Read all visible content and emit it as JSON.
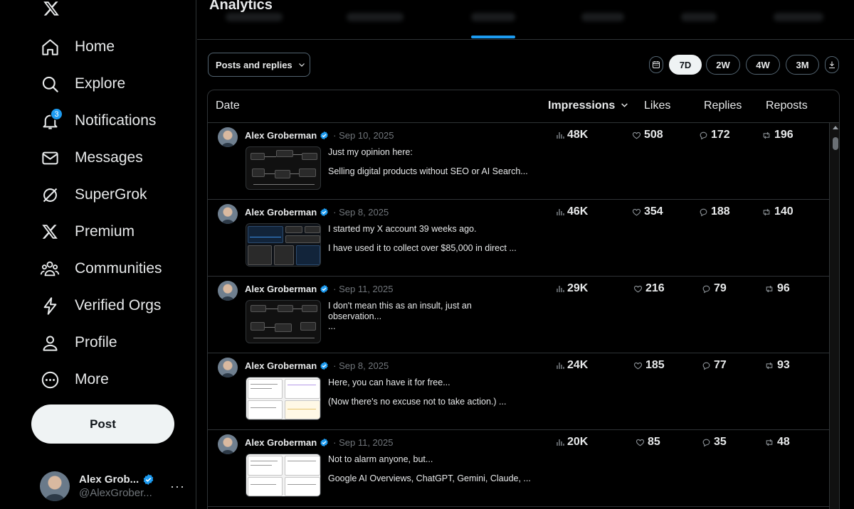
{
  "sidebar": {
    "nav": [
      {
        "label": "Home",
        "icon": "home-icon"
      },
      {
        "label": "Explore",
        "icon": "search-icon"
      },
      {
        "label": "Notifications",
        "icon": "bell-icon",
        "badge": "3"
      },
      {
        "label": "Messages",
        "icon": "mail-icon"
      },
      {
        "label": "SuperGrok",
        "icon": "grok-icon"
      },
      {
        "label": "Premium",
        "icon": "x-logo-icon"
      },
      {
        "label": "Communities",
        "icon": "people-icon"
      },
      {
        "label": "Verified Orgs",
        "icon": "lightning-icon"
      },
      {
        "label": "Profile",
        "icon": "person-icon"
      },
      {
        "label": "More",
        "icon": "more-circle-icon"
      }
    ],
    "post_label": "Post",
    "account": {
      "name": "Alex Grob...",
      "handle": "@AlexGrober...",
      "more": "···"
    }
  },
  "main": {
    "title": "Analytics",
    "filter": {
      "label": "Posts and replies"
    },
    "ranges": [
      {
        "label": "7D",
        "active": true
      },
      {
        "label": "2W",
        "active": false
      },
      {
        "label": "4W",
        "active": false
      },
      {
        "label": "3M",
        "active": false
      }
    ],
    "table": {
      "headers": {
        "date": "Date",
        "impressions": "Impressions",
        "likes": "Likes",
        "replies": "Replies",
        "reposts": "Reposts"
      },
      "rows": [
        {
          "name": "Alex Groberman",
          "date": "· Sep 10, 2025",
          "text1": "Just my opinion here:",
          "text2": "Selling digital products without SEO or AI Search...",
          "impressions": "48K",
          "likes": "508",
          "replies": "172",
          "reposts": "196",
          "thumb": "dark"
        },
        {
          "name": "Alex Groberman",
          "date": "· Sep 8, 2025",
          "text1": "I started my X account 39 weeks ago.",
          "text2": "I have used it to collect over $85,000 in direct ...",
          "impressions": "46K",
          "likes": "354",
          "replies": "188",
          "reposts": "140",
          "thumb": "dark"
        },
        {
          "name": "Alex Groberman",
          "date": "· Sep 11, 2025",
          "text1": "I don't mean this as an insult, just an observation...",
          "text2": "...",
          "impressions": "29K",
          "likes": "216",
          "replies": "79",
          "reposts": "96",
          "thumb": "dark"
        },
        {
          "name": "Alex Groberman",
          "date": "· Sep 8, 2025",
          "text1": "Here, you can have it for free...",
          "text2": "(Now there's no excuse not to take action.) ...",
          "impressions": "24K",
          "likes": "185",
          "replies": "77",
          "reposts": "93",
          "thumb": "light"
        },
        {
          "name": "Alex Groberman",
          "date": "· Sep 11, 2025",
          "text1": "Not to alarm anyone, but...",
          "text2": "Google AI Overviews, ChatGPT, Gemini, Claude, ...",
          "impressions": "20K",
          "likes": "85",
          "replies": "35",
          "reposts": "48",
          "thumb": "light"
        }
      ]
    }
  },
  "colors": {
    "accent": "#1d9bf0",
    "text": "#e7e9ea",
    "muted": "#71767b",
    "border": "#2f3336",
    "background": "#000000"
  }
}
